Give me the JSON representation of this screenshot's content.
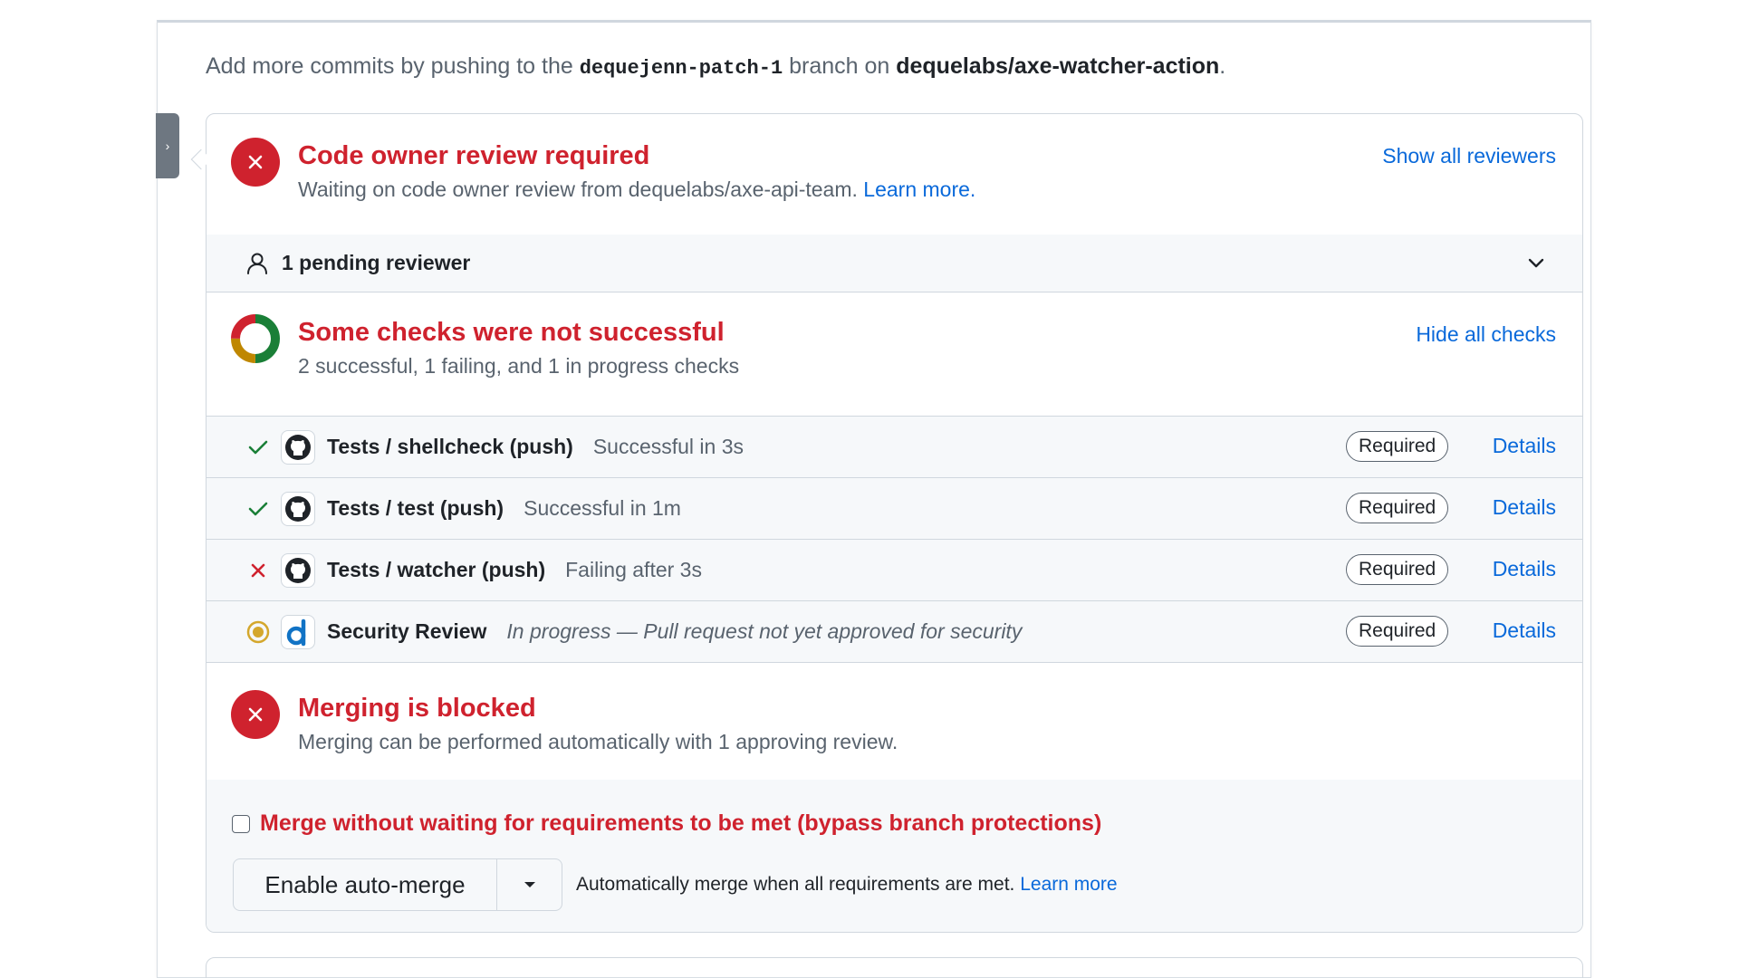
{
  "intro": {
    "prefix": "Add more commits by pushing to the ",
    "branch": "dequejenn-patch-1",
    "middle": " branch on ",
    "repo": "dequelabs/axe-watcher-action",
    "suffix": "."
  },
  "review": {
    "title": "Code owner review required",
    "subtitle": "Waiting on code owner review from dequelabs/axe-api-team. ",
    "learn_more": "Learn more.",
    "show_all": "Show all reviewers",
    "pending": "1 pending reviewer"
  },
  "checks": {
    "title": "Some checks were not successful",
    "subtitle": "2 successful, 1 failing, and 1 in progress checks",
    "hide_all": "Hide all checks",
    "required_label": "Required",
    "details_label": "Details",
    "items": [
      {
        "status": "success",
        "name": "Tests / shellcheck (push)",
        "desc": "Successful in 3s",
        "app": "github-icon"
      },
      {
        "status": "success",
        "name": "Tests / test (push)",
        "desc": "Successful in 1m",
        "app": "github-icon"
      },
      {
        "status": "failure",
        "name": "Tests / watcher (push)",
        "desc": "Failing after 3s",
        "app": "github-icon"
      },
      {
        "status": "pending",
        "name": "Security Review",
        "desc": "In progress — Pull request not yet approved for security",
        "app": "deque-icon"
      }
    ],
    "donut_colors": {
      "success": "#1a7f37",
      "failure": "#cf222e",
      "pending": "#bf8700"
    }
  },
  "blocked": {
    "title": "Merging is blocked",
    "subtitle": "Merging can be performed automatically with 1 approving review."
  },
  "merge": {
    "bypass_label": "Merge without waiting for requirements to be met (bypass branch protections)",
    "button_label": "Enable auto-merge",
    "note": "Automatically merge when all requirements are met. ",
    "note_link": "Learn more"
  },
  "colors": {
    "danger": "#cf222e",
    "accent": "#0969da",
    "success": "#1a7f37",
    "attention": "#d4a72c"
  }
}
